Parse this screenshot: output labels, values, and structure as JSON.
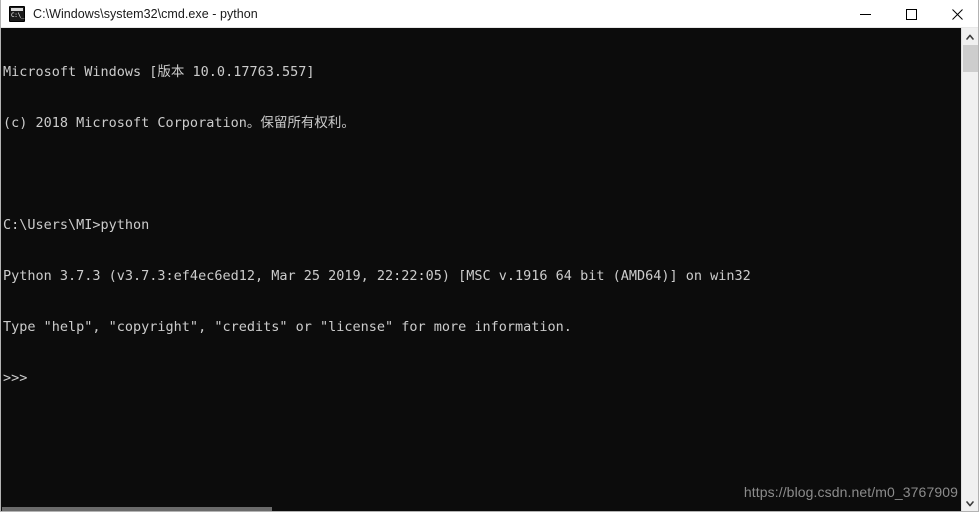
{
  "window": {
    "title": "C:\\Windows\\system32\\cmd.exe - python",
    "app_icon_name": "cmd-console-icon",
    "background_color": "#0c0c0c",
    "foreground_color": "#cccccc",
    "titlebar_color": "#ffffff"
  },
  "controls": {
    "minimize_label": "Minimize",
    "maximize_label": "Maximize",
    "close_label": "Close"
  },
  "console": {
    "lines": [
      "Microsoft Windows [版本 10.0.17763.557]",
      "(c) 2018 Microsoft Corporation。保留所有权利。",
      "",
      "C:\\Users\\MI>python",
      "Python 3.7.3 (v3.7.3:ef4ec6ed12, Mar 25 2019, 22:22:05) [MSC v.1916 64 bit (AMD64)] on win32",
      "Type \"help\", \"copyright\", \"credits\" or \"license\" for more information.",
      ">>>"
    ],
    "prompt": ">>>",
    "current_directory": "C:\\Users\\MI",
    "command_entered": "python",
    "python_version": "3.7.3",
    "python_build": "v3.7.3:ef4ec6ed12",
    "python_build_date": "Mar 25 2019, 22:22:05",
    "compiler": "MSC v.1916 64 bit (AMD64)",
    "platform": "win32",
    "windows_version": "10.0.17763.557",
    "copyright": "(c) 2018 Microsoft Corporation。保留所有权利。"
  },
  "watermark": {
    "text": "https://blog.csdn.net/m0_3767909",
    "color": "#8c8c8c"
  },
  "scrollbars": {
    "vertical_up_arrow": "▲",
    "vertical_down_arrow": "▼"
  }
}
